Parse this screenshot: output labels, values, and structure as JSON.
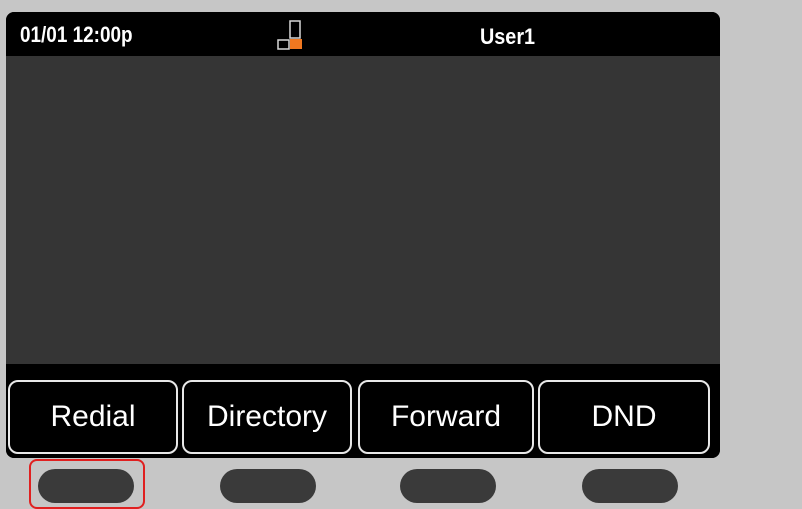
{
  "status_bar": {
    "datetime": "01/01 12:00p",
    "user": "User1",
    "line_icon": "line-status-icon"
  },
  "softkeys": [
    {
      "label": "Redial"
    },
    {
      "label": "Directory"
    },
    {
      "label": "Forward"
    },
    {
      "label": "DND"
    }
  ],
  "hardware_buttons": [
    "softkey-button-1",
    "softkey-button-2",
    "softkey-button-3",
    "softkey-button-4"
  ],
  "colors": {
    "screen_bg": "#353535",
    "bar_bg": "#000000",
    "text": "#ffffff",
    "icon_accent": "#f07820",
    "highlight": "#e02020",
    "device_bg": "#c6c6c6"
  }
}
